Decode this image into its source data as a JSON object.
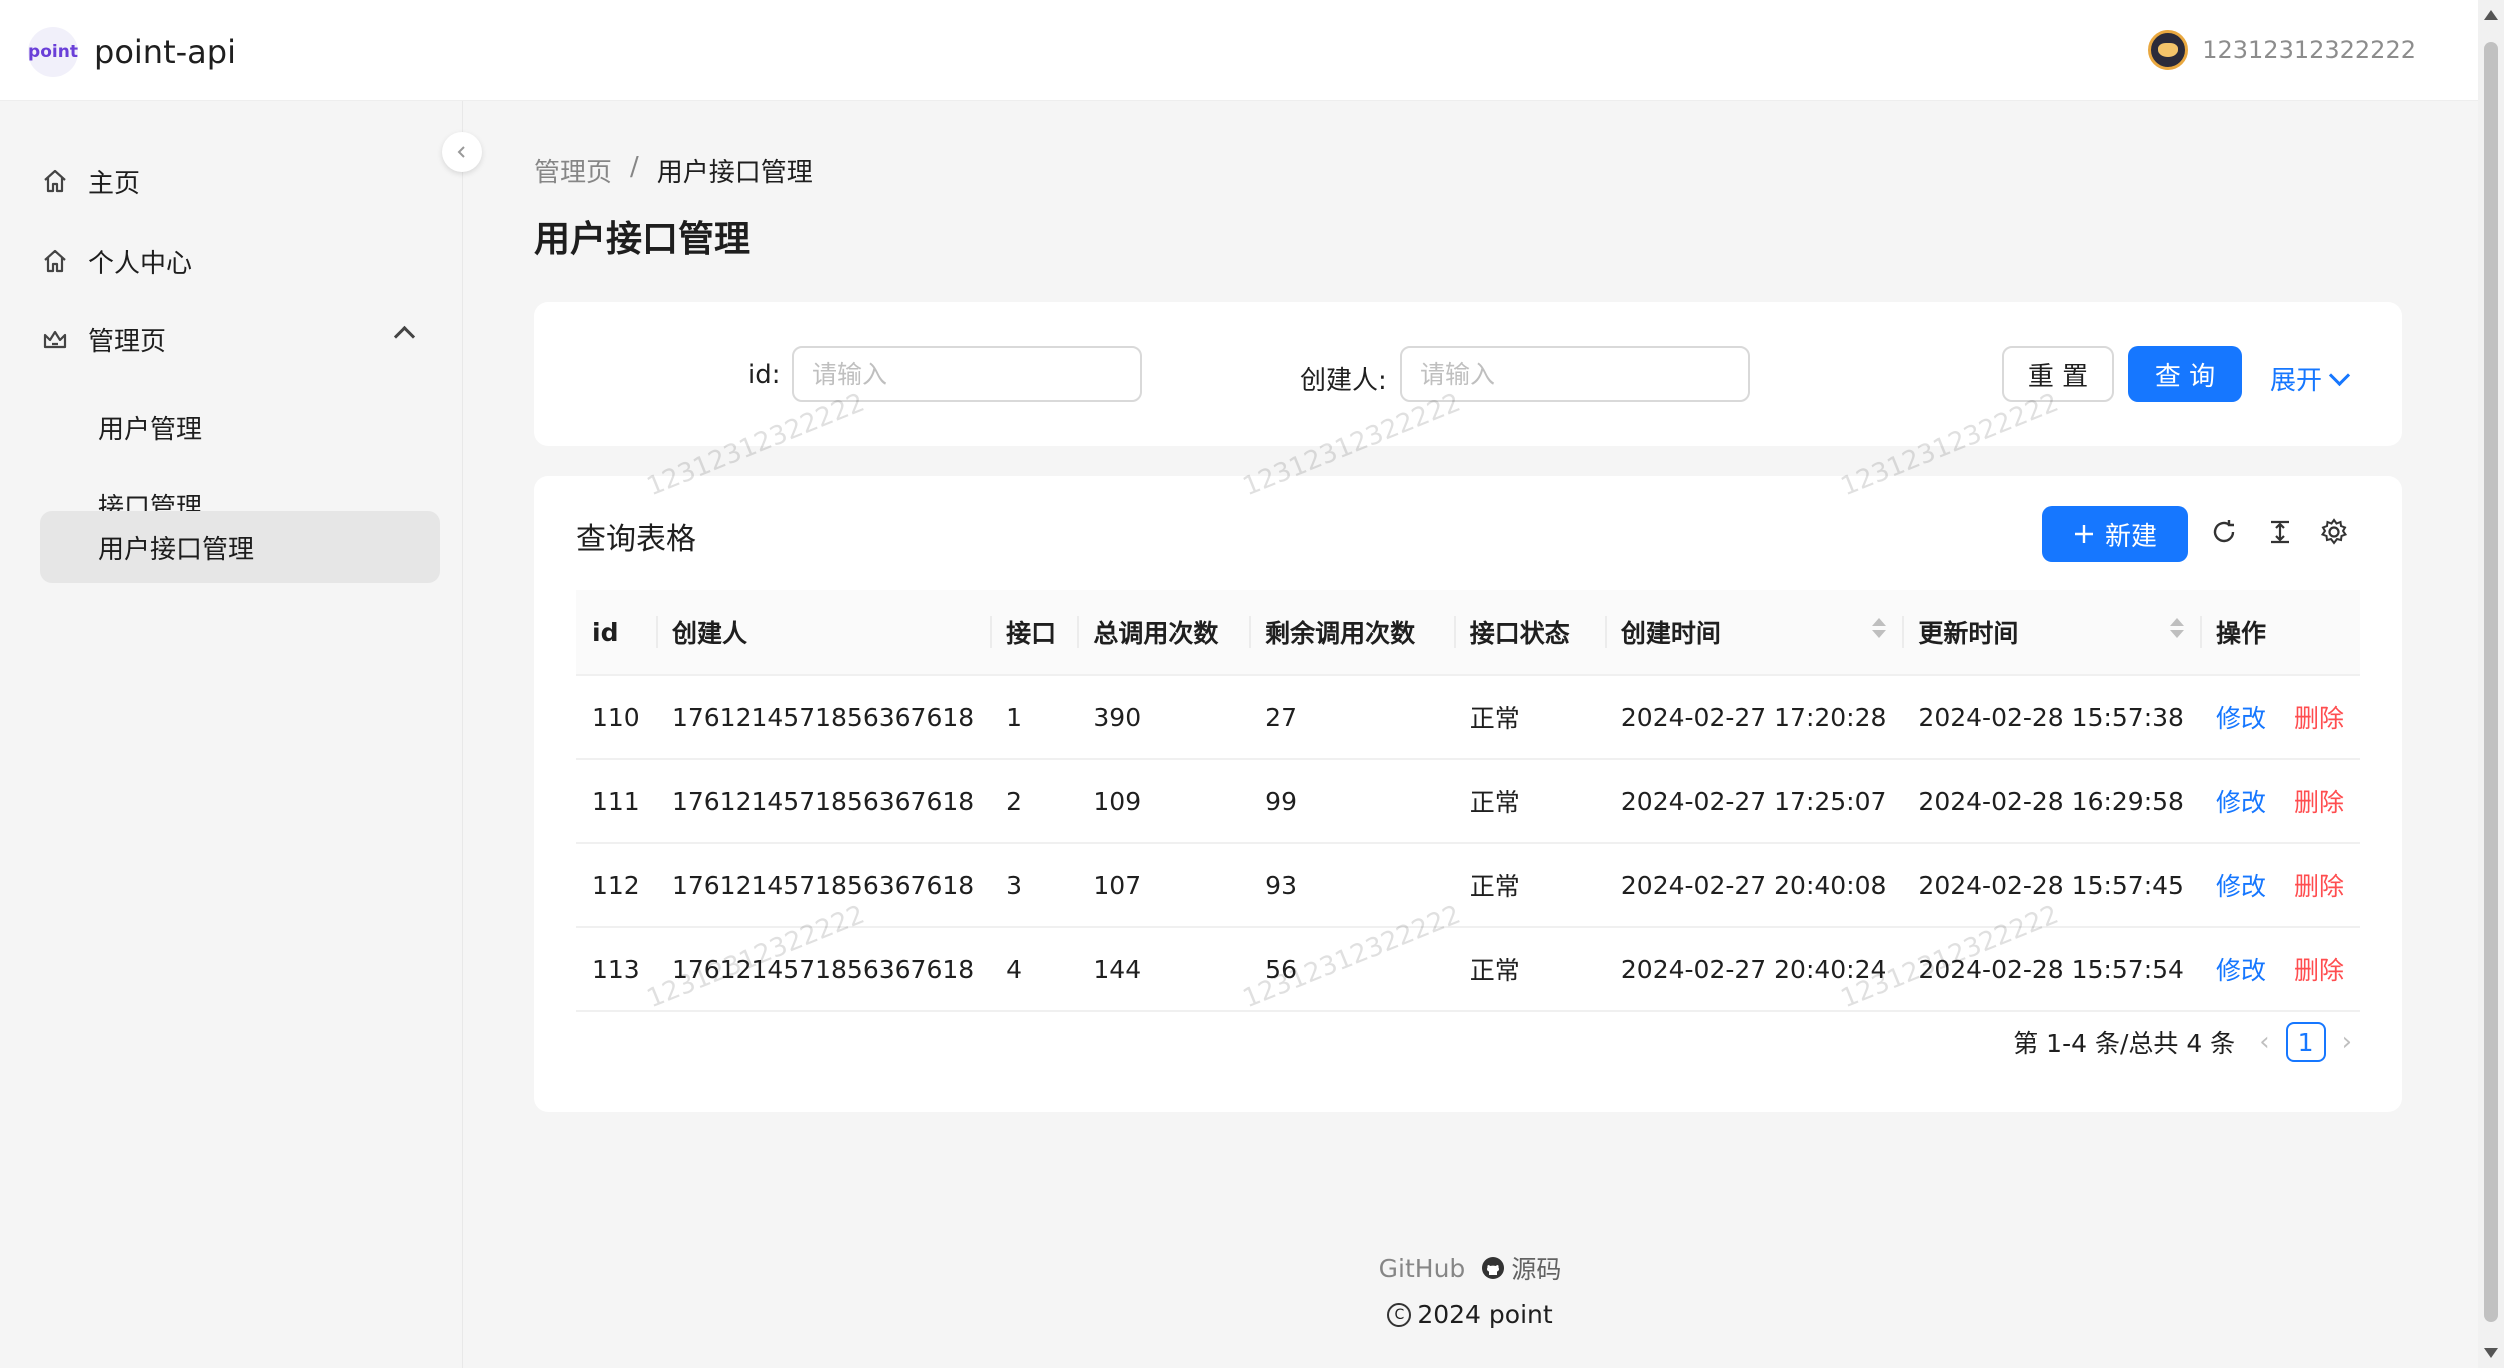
{
  "header": {
    "logo_text": "point",
    "app_title": "point-api",
    "user_name": "12312312322222"
  },
  "sidebar": {
    "items": [
      {
        "label": "主页",
        "icon": "home-icon"
      },
      {
        "label": "个人中心",
        "icon": "home-icon"
      },
      {
        "label": "管理页",
        "icon": "crown-icon"
      }
    ],
    "sub_items": [
      {
        "label": "用户管理"
      },
      {
        "label": "接口管理"
      },
      {
        "label": "用户接口管理",
        "active": true
      }
    ]
  },
  "breadcrumb": {
    "parent": "管理页",
    "separator": "/",
    "current": "用户接口管理"
  },
  "page_title": "用户接口管理",
  "search_form": {
    "fields": [
      {
        "label": "id",
        "placeholder": "请输入"
      },
      {
        "label": "创建人",
        "placeholder": "请输入"
      }
    ],
    "colon": ":",
    "reset_label": "重 置",
    "query_label": "查 询",
    "expand_label": "展开"
  },
  "table": {
    "title": "查询表格",
    "new_label": "新建",
    "columns": [
      "id",
      "创建人",
      "接口",
      "总调用次数",
      "剩余调用次数",
      "接口状态",
      "创建时间",
      "更新时间",
      "操作"
    ],
    "rows": [
      [
        "110",
        "1761214571856367618",
        "1",
        "390",
        "27",
        "正常",
        "2024-02-27 17:20:28",
        "2024-02-28 15:57:38"
      ],
      [
        "111",
        "1761214571856367618",
        "2",
        "109",
        "99",
        "正常",
        "2024-02-27 17:25:07",
        "2024-02-28 16:29:58"
      ],
      [
        "112",
        "1761214571856367618",
        "3",
        "107",
        "93",
        "正常",
        "2024-02-27 20:40:08",
        "2024-02-28 15:57:45"
      ],
      [
        "113",
        "1761214571856367618",
        "4",
        "144",
        "56",
        "正常",
        "2024-02-27 20:40:24",
        "2024-02-28 15:57:54"
      ]
    ],
    "edit_label": "修改",
    "delete_label": "删除",
    "pagination": {
      "summary": "第 1-4 条/总共 4 条",
      "current_page": "1"
    }
  },
  "footer": {
    "github_label": "GitHub",
    "source_label": "源码",
    "copyright": "2024 point"
  },
  "watermark": "12312312322222",
  "colors": {
    "primary": "#1677ff",
    "danger": "#ff4d4f",
    "background": "#f5f5f5"
  }
}
